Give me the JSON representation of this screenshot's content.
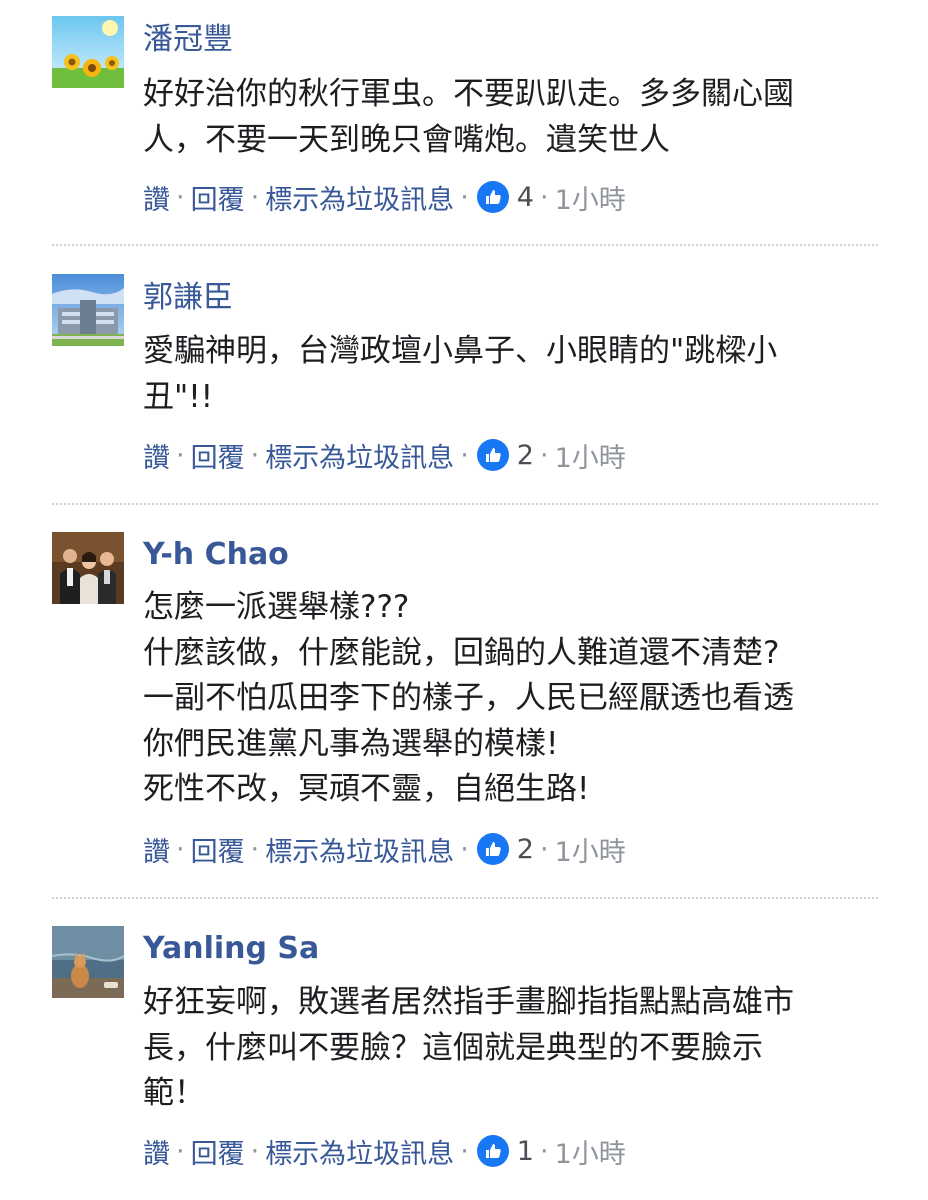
{
  "comments": [
    {
      "author": "潘冠豐",
      "lines": [
        "好好治你的秋行軍虫。不要趴趴走。多多關心國",
        "人，不要一天到晚只會嘴炮。遺笑世人"
      ],
      "actions": {
        "like": "讚",
        "reply": "回覆",
        "spam": "標示為垃圾訊息",
        "reactions": "4",
        "time": "1小時"
      },
      "avatar_icon": "sunflower-field-avatar"
    },
    {
      "author": "郭謙臣",
      "lines": [
        "愛騙神明，台灣政壇小鼻子、小眼睛的\"跳樑小",
        "丑\"!!"
      ],
      "actions": {
        "like": "讚",
        "reply": "回覆",
        "spam": "標示為垃圾訊息",
        "reactions": "2",
        "time": "1小時"
      },
      "avatar_icon": "building-avatar"
    },
    {
      "author": "Y-h Chao",
      "lines": [
        "怎麼一派選舉樣???",
        "什麼該做，什麼能說，回鍋的人難道還不清楚?",
        "一副不怕瓜田李下的樣子，人民已經厭透也看透",
        "你們民進黨凡事為選舉的模樣!",
        "死性不改，冥頑不靈，自絕生路!"
      ],
      "actions": {
        "like": "讚",
        "reply": "回覆",
        "spam": "標示為垃圾訊息",
        "reactions": "2",
        "time": "1小時"
      },
      "avatar_icon": "group-photo-avatar"
    },
    {
      "author": "Yanling Sa",
      "lines": [
        "好狂妄啊，敗選者居然指手畫腳指指點點高雄市",
        "長，什麼叫不要臉？這個就是典型的不要臉示",
        "範！"
      ],
      "actions": {
        "like": "讚",
        "reply": "回覆",
        "spam": "標示為垃圾訊息",
        "reactions": "1",
        "time": "1小時"
      },
      "avatar_icon": "cat-by-water-avatar"
    }
  ],
  "colors": {
    "author": "#385898",
    "body": "#1c1e21",
    "action_link": "#385898",
    "meta": "#90949c",
    "like_badge": "#1877f2",
    "divider": "#cfd1d5"
  }
}
